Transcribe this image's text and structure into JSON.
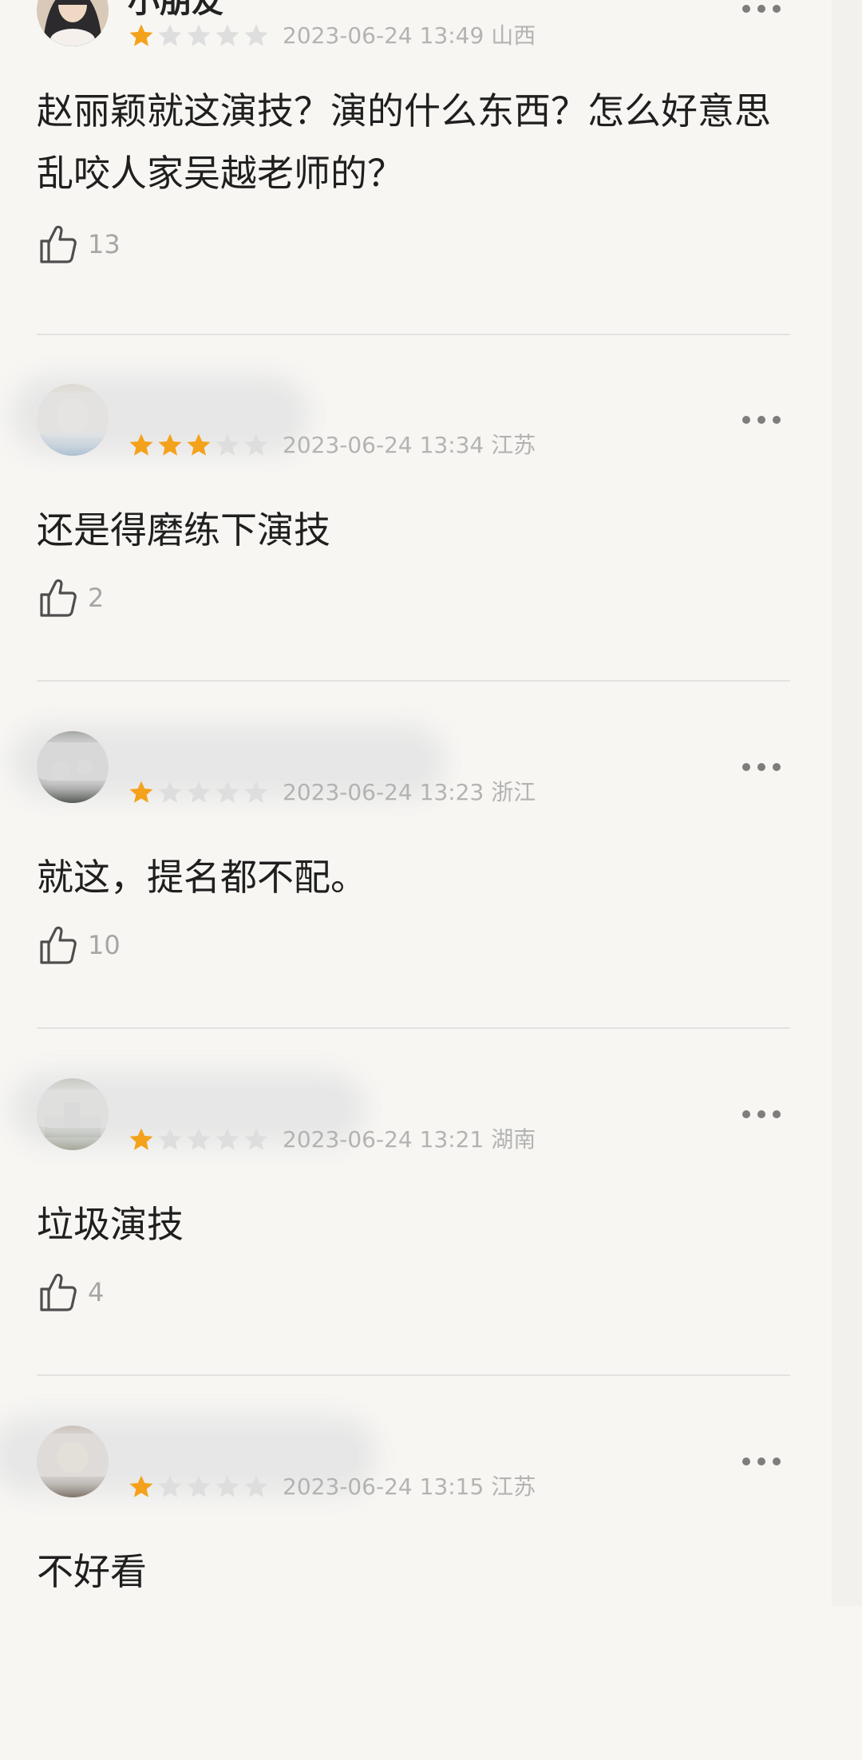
{
  "colors": {
    "background": "#f7f6f3",
    "star_filled": "#f4a21c",
    "star_empty": "#dedede",
    "meta_text": "#b3b3b3",
    "content_text": "#1f1f1f",
    "divider": "#e2e2e2"
  },
  "icons": {
    "like": "thumbs-up-icon",
    "more": "more-horizontal-icon",
    "star": "star-icon"
  },
  "comments": [
    {
      "username": "小朋友",
      "rating": 1,
      "date": "2023-06-24 13:49",
      "location": "山西",
      "content": "赵丽颖就这演技？演的什么东西？怎么好意思乱咬人家吴越老师的？",
      "likes": "13"
    },
    {
      "username": "",
      "rating": 3,
      "date": "2023-06-24 13:34",
      "location": "江苏",
      "content": "还是得磨练下演技",
      "likes": "2"
    },
    {
      "username": "",
      "rating": 1,
      "date": "2023-06-24 13:23",
      "location": "浙江",
      "content": "就这，提名都不配。",
      "likes": "10"
    },
    {
      "username": "",
      "rating": 1,
      "date": "2023-06-24 13:21",
      "location": "湖南",
      "content": "垃圾演技",
      "likes": "4"
    },
    {
      "username": "",
      "rating": 1,
      "date": "2023-06-24 13:15",
      "location": "江苏",
      "content": "不好看",
      "likes": ""
    }
  ]
}
